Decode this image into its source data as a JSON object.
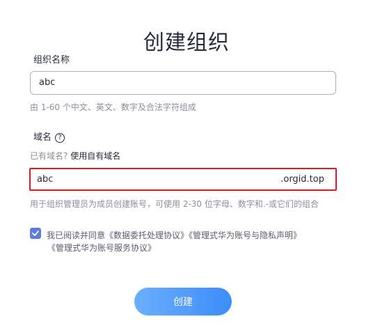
{
  "page": {
    "title": "创建组织"
  },
  "org_name": {
    "label": "组织名称",
    "value": "abc",
    "hint": "由 1-60 个中文、英文、数字及合法字符组成"
  },
  "domain": {
    "label": "域名",
    "help_icon": "question-circle-icon",
    "existing_prompt": "已有域名?",
    "existing_link": "使用自有域名",
    "value": "abc",
    "suffix": ".orgid.top",
    "hint": "用于组织管理员为成员创建账号，可使用 2-30 位字母、数字和.-或它们的组合",
    "error_border_color": "#e0191f"
  },
  "agreement": {
    "checked": true,
    "prefix": "我已阅读并同意",
    "link1": "《数据委托处理协议》",
    "link2": "《管理式华为账号与隐私声明》",
    "link3": "《管理式华为账号服务协议》"
  },
  "actions": {
    "create_label": "创建"
  },
  "colors": {
    "accent": "#5e7ce0",
    "button_gradient_start": "#6aafff",
    "button_gradient_end": "#3d8cf8"
  }
}
